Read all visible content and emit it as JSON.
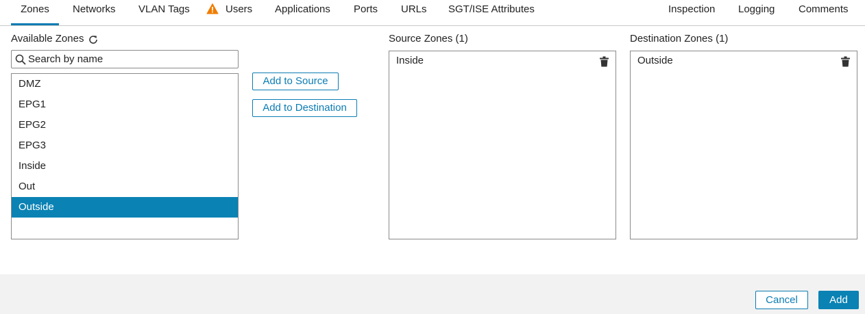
{
  "tabs": [
    {
      "label": "Zones",
      "active": true
    },
    {
      "label": "Networks"
    },
    {
      "label": "VLAN Tags"
    },
    {
      "label": "Users",
      "icon": "warning-icon"
    },
    {
      "label": "Applications"
    },
    {
      "label": "Ports"
    },
    {
      "label": "URLs"
    },
    {
      "label": "SGT/ISE Attributes"
    },
    {
      "label": "Inspection"
    },
    {
      "label": "Logging"
    },
    {
      "label": "Comments"
    }
  ],
  "available": {
    "title": "Available Zones",
    "refresh_icon": "refresh-icon",
    "search_placeholder": "Search by name",
    "items": [
      "DMZ",
      "EPG1",
      "EPG2",
      "EPG3",
      "Inside",
      "Out",
      "Outside"
    ],
    "selected": "Outside"
  },
  "actions": {
    "add_to_source": "Add to Source",
    "add_to_destination": "Add to Destination"
  },
  "source": {
    "title": "Source Zones (1)",
    "items": [
      "Inside"
    ]
  },
  "destination": {
    "title": "Destination Zones (1)",
    "items": [
      "Outside"
    ]
  },
  "footer": {
    "cancel": "Cancel",
    "add": "Add"
  },
  "colors": {
    "accent": "#0a82b4",
    "warning": "#f07d00"
  }
}
